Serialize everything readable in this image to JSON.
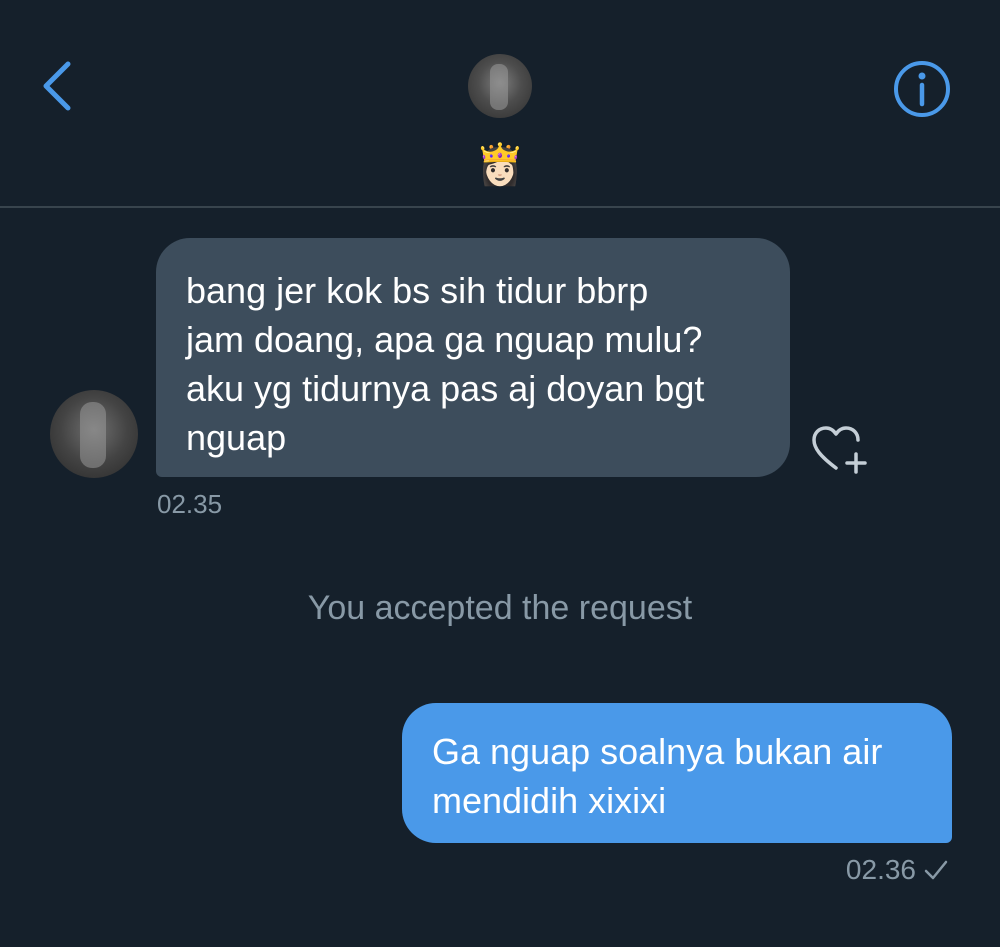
{
  "header": {
    "name_emoji": "👸🏻"
  },
  "messages": {
    "incoming": {
      "text": "bang jer kok bs sih tidur bbrp\njam doang, apa ga nguap mulu?\naku yg tidurnya pas aj doyan bgt\nnguap",
      "time": "02.35"
    },
    "system": "You accepted the request",
    "outgoing": {
      "text": "Ga nguap soalnya bukan air\nmendidih xixixi",
      "time": "02.36"
    }
  },
  "colors": {
    "background": "#15202b",
    "accent": "#4a99e9",
    "incoming_bubble": "#3d4d5c",
    "muted_text": "#8899a6"
  },
  "icons": {
    "back": "chevron-left-icon",
    "info": "info-icon",
    "react": "heart-plus-icon",
    "read": "checkmark-icon"
  }
}
